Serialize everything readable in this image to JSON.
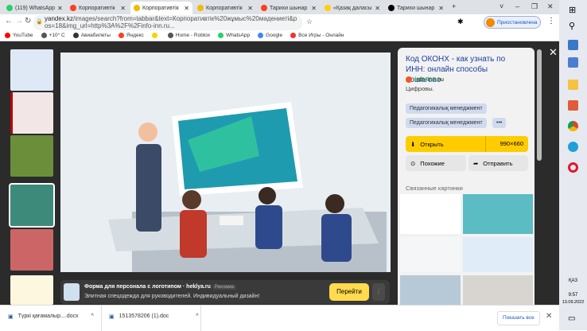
{
  "tabs": [
    {
      "label": "(119) WhatsApp",
      "color": "#25d366"
    },
    {
      "label": "Корпоративтік",
      "color": "#fc3f1d"
    },
    {
      "label": "Корпоративтік",
      "color": "#f5b800",
      "active": true
    },
    {
      "label": "Корпоративтік",
      "color": "#f5b800"
    },
    {
      "label": "Тарихи шынар",
      "color": "#fc3f1d"
    },
    {
      "label": "«Қазақ даласы",
      "color": "#ffd000"
    },
    {
      "label": "Тарихи шынар",
      "color": "#000000"
    }
  ],
  "window_controls": {
    "chevron": "˅",
    "minimize": "–",
    "restore": "❐",
    "close": "✕",
    "new_tab": "+"
  },
  "address": {
    "domain": "yandex.kz",
    "path": "/images/search?from=tabbar&text=Корпоративтік%20жұмыс%20мәдениеті&pos=18&img_url=http%3A%2F%2Finfo-inn.ru...",
    "profile": "Приостановлена"
  },
  "bookmarks": [
    "YouTube",
    "+10° C",
    "Авиабилеты",
    "Яндекс",
    "",
    "Home - Roblox",
    "WhatsApp",
    "Google",
    "Все Игры - Онлайн"
  ],
  "panel": {
    "title": "Код ОКОНХ - как узнать по ИНН: онлайн способы пошагово",
    "source": "info-inn.ru",
    "description": "Цифровы.",
    "tags": [
      "Педагогикалық менеджмент",
      "Педагогикалық менеджмент"
    ],
    "more": "•••",
    "open_label": "Открыть",
    "size": "990×660",
    "similar_label": "Похожие",
    "share_label": "Отправить",
    "related_title": "Связанные картинки"
  },
  "ad": {
    "title": "Форма для персонала с логотипом · heklya.ru",
    "badge": "Реклама",
    "text": "Элитная спецодежда для руководителей. Индивидуальный дизайн!",
    "button": "Перейти"
  },
  "downloads": {
    "items": [
      "Түркі қағамалыр....docx",
      "1513578206 (1).doc"
    ],
    "show_all": "Показать все"
  },
  "taskbar": {
    "lang": "ҚАЗ",
    "time": "9:57",
    "date": "13.09.2022"
  },
  "colors": {
    "accent": "#ffcc00",
    "link": "#1a3ea0",
    "dark": "#2b2b2b"
  }
}
